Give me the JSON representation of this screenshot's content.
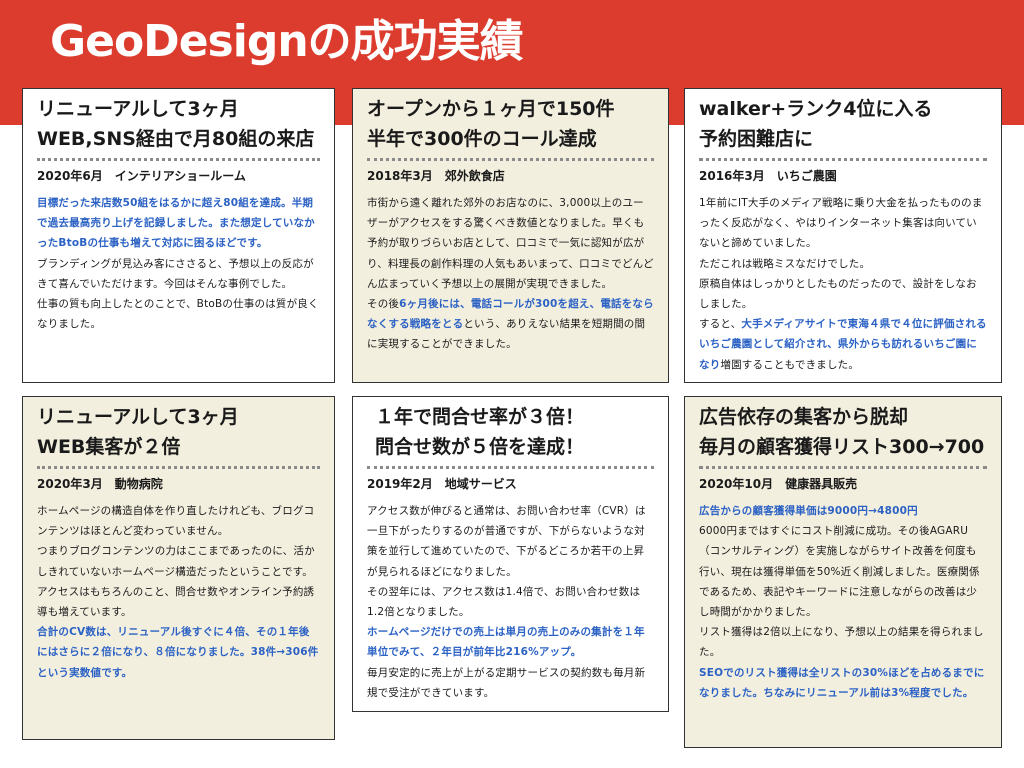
{
  "header": {
    "title": "GeoDesignの成功実績"
  },
  "cards": [
    {
      "title_lines": [
        "リニューアルして3ヶ月",
        "WEB,SNS経由で月80組の来店"
      ],
      "meta": "2020年6月　インテリアショールーム",
      "body": [
        {
          "t": "目標だった来店数50組をはるかに超え80組を達成。半期で過去最高売り上げを記録しました。また想定していなかったBtoBの仕事も増えて対応に困るほどです。",
          "hl": true
        },
        {
          "t": "ブランディングが見込み客にささると、予想以上の反応がきて喜んでいただけます。今回はそんな事例でした。",
          "hl": false
        },
        {
          "t": "仕事の質も向上したとのことで、BtoBの仕事のは質が良くなりました。",
          "hl": false
        }
      ]
    },
    {
      "title_lines": [
        "オープンから１ヶ月で150件",
        "半年で300件のコール達成"
      ],
      "meta": "2018年3月　郊外飲食店",
      "body": [
        {
          "t": "市街から遠く離れた郊外のお店なのに、3,000以上のユーザーがアクセスをする驚くべき数値となりました。早くも予約が取りづらいお店として、口コミで一気に認知が広がり、料理長の創作料理の人気もあいまって、口コミでどんどん広まっていく予想以上の展開が実現できました。",
          "hl": false
        },
        {
          "parts": [
            {
              "t": "その後",
              "hl": false
            },
            {
              "t": "6ヶ月後には、電話コールが300を超え、電話をならなくする戦略をとる",
              "hl": true
            },
            {
              "t": "という、ありえない結果を短期間の間に実現することができました。",
              "hl": false
            }
          ]
        }
      ]
    },
    {
      "title_lines": [
        "walker+ランク4位に入る",
        "予約困難店に"
      ],
      "meta": "2016年3月　いちご農園",
      "body": [
        {
          "t": "1年前にIT大手のメディア戦略に乗り大金を払ったもののまったく反応がなく、やはりインターネット集客は向いていないと諦めていました。",
          "hl": false
        },
        {
          "t": "ただこれは戦略ミスなだけでした。",
          "hl": false
        },
        {
          "t": "原稿自体はしっかりとしたものだったので、設計をしなおしました。",
          "hl": false
        },
        {
          "parts": [
            {
              "t": "すると、",
              "hl": false
            },
            {
              "t": "大手メディアサイトで東海４県で４位に評価されるいちご農園として紹介され、県外からも訪れるいちご園になり",
              "hl": true
            },
            {
              "t": "増園することもできました。",
              "hl": false
            }
          ]
        }
      ]
    },
    {
      "title_lines": [
        "リニューアルして3ヶ月",
        "WEB集客が２倍"
      ],
      "meta": "2020年3月　動物病院",
      "body": [
        {
          "t": "ホームページの構造自体を作り直したけれども、ブログコンテンツはほとんど変わっていません。",
          "hl": false
        },
        {
          "t": "つまりブログコンテンツの力はここまであったのに、活かしきれていないホームページ構造だったということです。",
          "hl": false
        },
        {
          "t": "アクセスはもちろんのこと、問合せ数やオンライン予約誘導も増えています。",
          "hl": false
        },
        {
          "t": "合計のCV数は、リニューアル後すぐに４倍、その１年後にはさらに２倍になり、８倍になりました。38件→306件という実数値です。",
          "hl": true
        }
      ]
    },
    {
      "title_lines": [
        "１年で問合せ率が３倍！",
        "問合せ数が５倍を達成！"
      ],
      "meta": "2019年2月　地域サービス",
      "body": [
        {
          "t": "アクセス数が伸びると通常は、お問い合わせ率（CVR）は一旦下がったりするのが普通ですが、下がらないような対策を並行して進めていたので、下がるどころか若干の上昇が見られるほどになりました。",
          "hl": false
        },
        {
          "t": "その翌年には、アクセス数は1.4倍で、お問い合わせ数は1.2倍となりました。",
          "hl": false
        },
        {
          "t": "ホームページだけでの売上は単月の売上のみの集計を１年単位でみて、２年目が前年比216%アップ。",
          "hl": true
        },
        {
          "t": "毎月安定的に売上が上がる定期サービスの契約数も毎月新規で受注ができています。",
          "hl": false
        }
      ]
    },
    {
      "title_lines": [
        "広告依存の集客から脱却",
        "毎月の顧客獲得リスト300→700"
      ],
      "meta": "2020年10月　健康器具販売",
      "body": [
        {
          "t": "広告からの顧客獲得単価は9000円→4800円",
          "hl": true
        },
        {
          "t": "6000円まではすぐにコスト削減に成功。その後AGARU（コンサルティング）を実施しながらサイト改善を何度も行い、現在は獲得単価を50%近く削減しました。医療関係であるため、表記やキーワードに注意しながらの改善は少し時間がかかりました。",
          "hl": false
        },
        {
          "t": "リスト獲得は2倍以上になり、予想以上の結果を得られました。",
          "hl": false
        },
        {
          "t": "SEOでのリスト獲得は全リストの30%ほどを占めるまでになりました。ちなみにリニューアル前は3%程度でした。",
          "hl": true
        }
      ]
    }
  ],
  "colors": {
    "banner": "#dc3c2d",
    "beige": "#f3efdf",
    "highlight": "#2c62c4"
  }
}
